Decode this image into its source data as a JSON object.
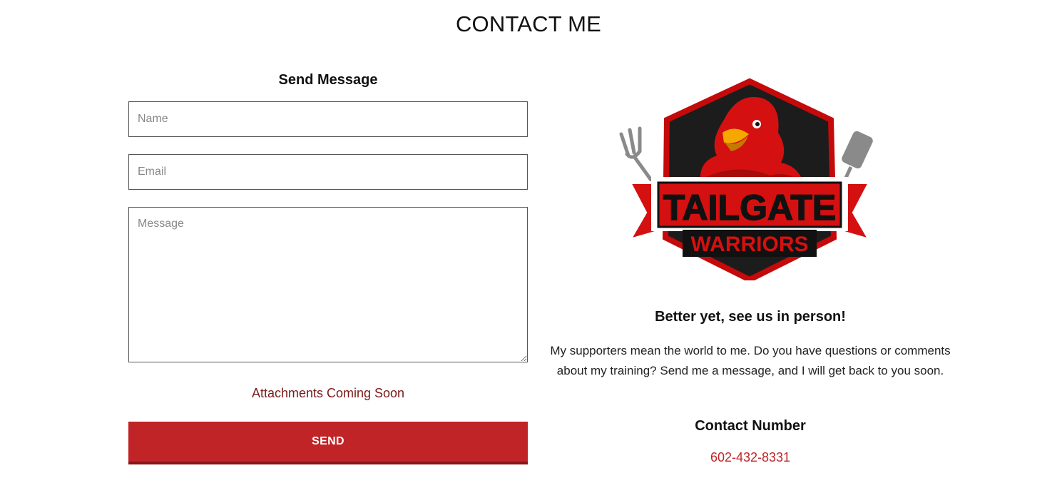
{
  "page": {
    "title": "CONTACT ME"
  },
  "form": {
    "heading": "Send Message",
    "name_placeholder": "Name",
    "email_placeholder": "Email",
    "message_placeholder": "Message",
    "attachments_note": "Attachments Coming Soon",
    "send_label": "SEND"
  },
  "info": {
    "logo": {
      "line1": "TAILGATE",
      "line2": "WARRIORS",
      "icon": "cardinal-mascot-logo"
    },
    "heading": "Better yet, see us in person!",
    "body": "My supporters mean the world to me. Do you have questions or comments about my training? Send me a message, and I will get back to you soon.",
    "contact_heading": "Contact Number",
    "phone": "602-432-8331"
  },
  "colors": {
    "accent": "#c02426",
    "accent_dark": "#8a1418",
    "note": "#7a1a1a",
    "text": "#111111"
  }
}
